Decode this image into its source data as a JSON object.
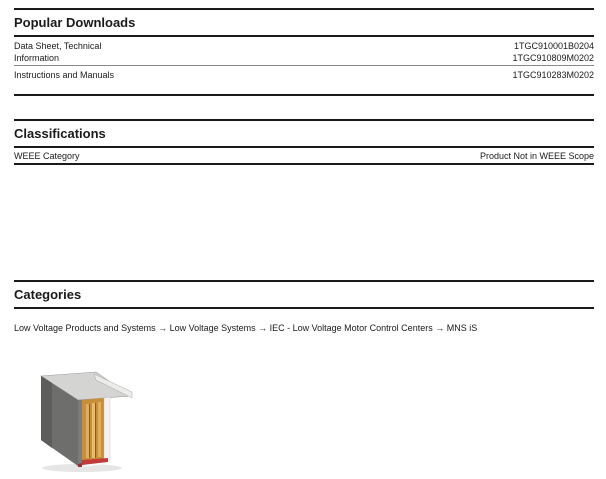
{
  "popular_downloads": {
    "title": "Popular Downloads",
    "rows": [
      {
        "label": "Data Sheet, Technical Information",
        "values": [
          "1TGC910001B0204",
          "1TGC910809M0202"
        ]
      },
      {
        "label": "Instructions and Manuals",
        "values": [
          "1TGC910283M0202"
        ]
      }
    ]
  },
  "classifications": {
    "title": "Classifications",
    "rows": [
      {
        "label": "WEEE Category",
        "value": "Product Not in WEEE Scope"
      }
    ]
  },
  "categories": {
    "title": "Categories",
    "breadcrumb": "Low Voltage Products and Systems → Low Voltage Systems → IEC - Low Voltage Motor Control Centers → MNS iS"
  },
  "colors": {
    "rule": "#1a1a1a",
    "text": "#1a1a1a",
    "product_body": "#6e6f6c",
    "product_accent": "#d9a040",
    "product_base": "#c23a3a"
  }
}
